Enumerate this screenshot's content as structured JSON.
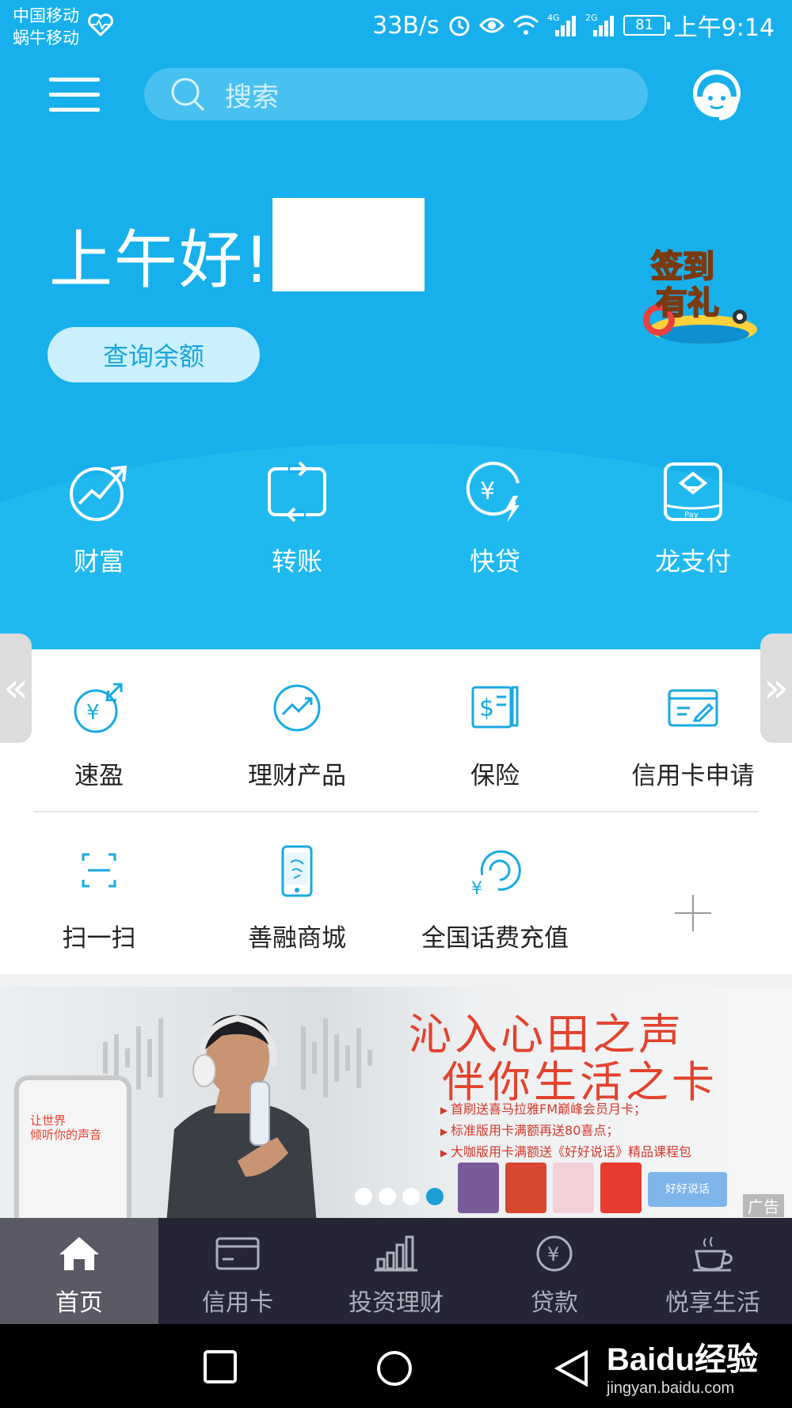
{
  "status_bar": {
    "carrier1": "中国移动",
    "carrier2": "蜗牛移动",
    "speed": "33B/s",
    "network1": "4G",
    "network2": "2G",
    "battery": "81",
    "time": "上午9:14"
  },
  "header": {
    "search_placeholder": "搜索",
    "menu_icon": "menu-icon",
    "service_icon": "customer-service-icon"
  },
  "hero": {
    "greeting": "上午好!",
    "balance_button": "查询余额",
    "checkin_line1": "签到",
    "checkin_line2": "有礼"
  },
  "quick_actions": [
    {
      "label": "财富",
      "icon": "wealth-icon"
    },
    {
      "label": "转账",
      "icon": "transfer-icon"
    },
    {
      "label": "快贷",
      "icon": "quick-loan-icon"
    },
    {
      "label": "龙支付",
      "icon": "long-pay-icon"
    }
  ],
  "services": [
    {
      "label": "速盈",
      "icon": "suying-icon"
    },
    {
      "label": "理财产品",
      "icon": "financial-products-icon"
    },
    {
      "label": "保险",
      "icon": "insurance-icon"
    },
    {
      "label": "信用卡申请",
      "icon": "credit-card-apply-icon"
    },
    {
      "label": "扫一扫",
      "icon": "scan-icon"
    },
    {
      "label": "善融商城",
      "icon": "mall-icon"
    },
    {
      "label": "全国话费充值",
      "icon": "phone-recharge-icon"
    }
  ],
  "banner": {
    "title1": "沁入心田之声",
    "title2": "伴你生活之卡",
    "lines": [
      "首刷送喜马拉雅FM巅峰会员月卡；",
      "标准版用卡满额再送80喜点；",
      "大咖版用卡满额送《好好说话》精品课程包"
    ],
    "phone_text1": "让世界",
    "phone_text2": "倾听你的声音",
    "card_text": "好好说话",
    "ad_tag": "广告",
    "slide_count": 4,
    "active_slide": 4
  },
  "bottom_nav": [
    {
      "label": "首页",
      "icon": "home-icon",
      "active": true
    },
    {
      "label": "信用卡",
      "icon": "credit-card-icon",
      "active": false
    },
    {
      "label": "投资理财",
      "icon": "investment-icon",
      "active": false
    },
    {
      "label": "贷款",
      "icon": "loan-icon",
      "active": false
    },
    {
      "label": "悦享生活",
      "icon": "coffee-icon",
      "active": false
    }
  ],
  "watermark": {
    "main": "Baidu经验",
    "sub": "jingyan.baidu.com"
  },
  "colors": {
    "primary_blue": "#17b0ec",
    "banner_red": "#e2432e",
    "nav_background": "#252535"
  }
}
